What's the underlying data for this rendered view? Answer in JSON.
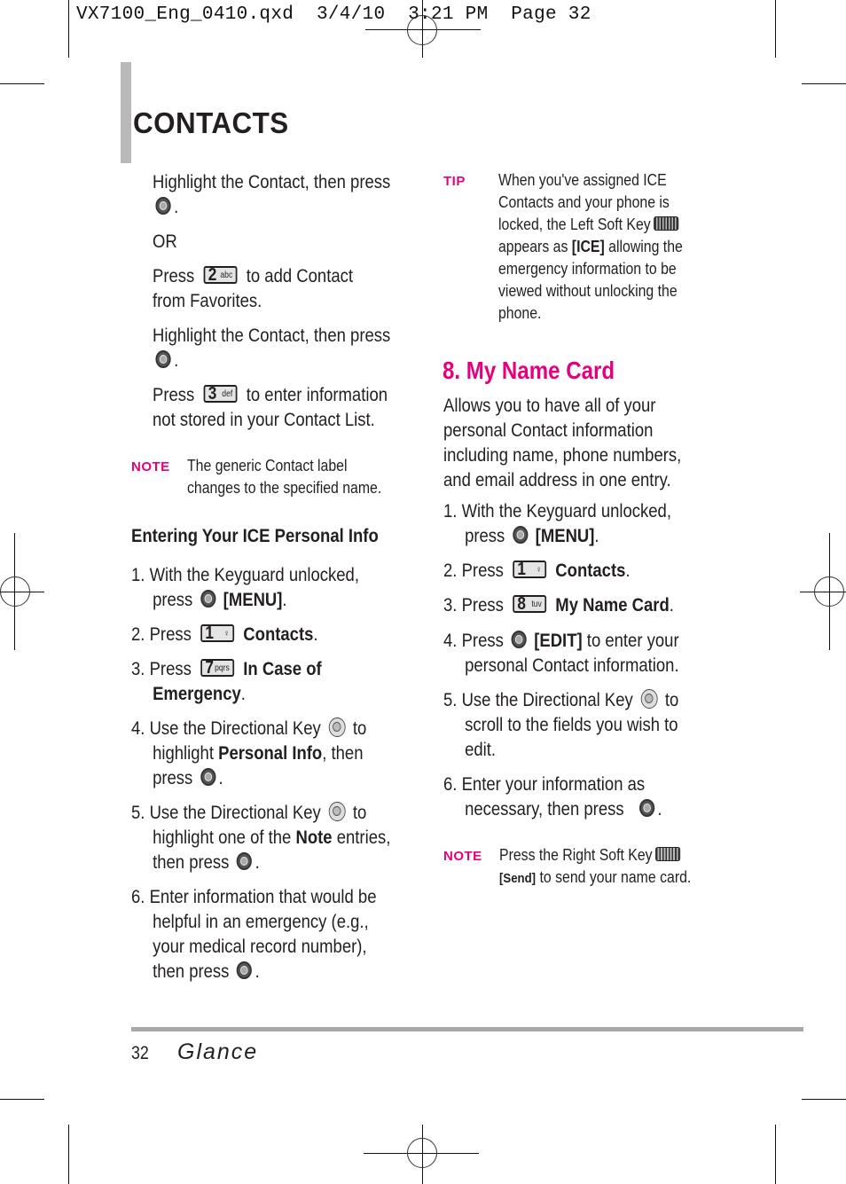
{
  "slug": "VX7100_Eng_0410.qxd  3/4/10  3:21 PM  Page 32",
  "section_title": "CONTACTS",
  "left": {
    "p1": "Highlight the Contact, then press",
    "or": "OR",
    "p2_a": "Press",
    "p2_b": "to add Contact",
    "p2_c": "from Favorites.",
    "p3": "Highlight the Contact, then press",
    "p4_a": "Press",
    "p4_b": "to enter information",
    "p4_c": "not stored in your Contact List.",
    "note_label": "NOTE",
    "note_l1": "The generic Contact label",
    "note_l2": "changes to the specified name.",
    "subhead": "Entering Your ICE Personal Info",
    "steps": {
      "s1_num": "1.",
      "s1_a": "With the Keyguard unlocked,",
      "s1_b": "press",
      "s1_c": "[MENU]",
      "s2_num": "2.",
      "s2_a": "Press",
      "s2_b": "Contacts",
      "s3_num": "3.",
      "s3_a": "Press",
      "s3_b": "In Case of",
      "s3_c": "Emergency",
      "s4_num": "4.",
      "s4_a": "Use the Directional Key",
      "s4_b": "to",
      "s4_c": "highlight",
      "s4_d": "Personal Info",
      "s4_e": ", then",
      "s4_f": "press",
      "s5_num": "5.",
      "s5_a": "Use the Directional Key",
      "s5_b": "to",
      "s5_c": "highlight one of the",
      "s5_d": "Note",
      "s5_e": "entries,",
      "s5_f": "then press",
      "s6_num": "6.",
      "s6_a": "Enter information that would be",
      "s6_b": "helpful in an emergency (e.g.,",
      "s6_c": "your medical record number),",
      "s6_d": "then press"
    }
  },
  "keys": {
    "k2": {
      "num": "2",
      "letters": "abc"
    },
    "k3": {
      "num": "3",
      "letters": "def"
    },
    "k1": {
      "num": "1",
      "letters": "♀"
    },
    "k7": {
      "num": "7",
      "letters": "pqrs"
    },
    "k8": {
      "num": "8",
      "letters": "tuv"
    }
  },
  "right": {
    "tip_label": "TIP",
    "tip_lines": [
      "When you've assigned ICE",
      "Contacts and your phone is",
      "locked, the Left Soft Key",
      "appears as",
      "[ICE]",
      "allowing the",
      "emergency information to be",
      "viewed without unlocking the",
      "phone."
    ],
    "heading": "8. My Name Card",
    "intro": [
      "Allows you to have all of your",
      "personal Contact information",
      "including name, phone numbers,",
      "and email address in one entry."
    ],
    "steps": {
      "s1_num": "1.",
      "s1_a": "With the Keyguard unlocked,",
      "s1_b": "press",
      "s1_c": "[MENU]",
      "s2_num": "2.",
      "s2_a": "Press",
      "s2_b": "Contacts",
      "s3_num": "3.",
      "s3_a": "Press",
      "s3_b": "My Name Card",
      "s4_num": "4.",
      "s4_a": "Press",
      "s4_b": "[EDIT]",
      "s4_c": "to enter your",
      "s4_d": "personal Contact information.",
      "s5_num": "5.",
      "s5_a": "Use the Directional Key",
      "s5_b": "to",
      "s5_c": "scroll to the fields you wish to",
      "s5_d": "edit.",
      "s6_num": "6.",
      "s6_a": "Enter your information as",
      "s6_b": "necessary, then press"
    },
    "note_label": "NOTE",
    "note_l1": "Press the Right Soft Key",
    "note_send": "[Send]",
    "note_l2": "to send your name card."
  },
  "footer": {
    "page_number": "32",
    "brand": "Glance"
  },
  "colors": {
    "accent_pink": "#e5007e",
    "title_bar_gray": "#b9b9b9",
    "footer_bar_gray": "#a8a8a8"
  }
}
